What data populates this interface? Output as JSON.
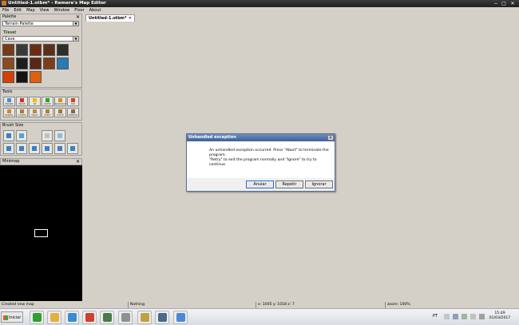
{
  "window": {
    "title": "Untitled-1.otbm* - Remere's Map Editor",
    "controls": {
      "minimize": "−",
      "maximize": "□",
      "close": "✕"
    }
  },
  "menubar": [
    "File",
    "Edit",
    "Map",
    "View",
    "Window",
    "Floor",
    "About"
  ],
  "palette": {
    "header": "Palette",
    "close": "✕",
    "selected": "Terrain Palette",
    "tileset_label": "Tileset",
    "tileset_selected": "Cave",
    "tiles": [
      {
        "name": "tile-dirt",
        "color": "#7a3a18"
      },
      {
        "name": "tile-cave-ore",
        "color": "#3a3a3a"
      },
      {
        "name": "tile-mud",
        "color": "#6b2d12"
      },
      {
        "name": "tile-mud-2",
        "color": "#5a3018"
      },
      {
        "name": "tile-stone",
        "color": "#2d2d2d"
      },
      {
        "name": "tile-rock",
        "color": "#8b4b22"
      },
      {
        "name": "tile-dark-rock",
        "color": "#1e1e1e"
      },
      {
        "name": "tile-lava-rock",
        "color": "#5b2616"
      },
      {
        "name": "tile-brown",
        "color": "#7b3e1d"
      },
      {
        "name": "tile-water",
        "color": "#2a7ab4"
      },
      {
        "name": "tile-lava",
        "color": "#d4400a"
      },
      {
        "name": "tile-black",
        "color": "#141414"
      },
      {
        "name": "tile-fire",
        "color": "#e06010"
      }
    ]
  },
  "tools": {
    "header": "Tools",
    "buttons": [
      {
        "label": "ERASER",
        "icon": "eraser-icon",
        "color": "#4a8fd8"
      },
      {
        "label": "ERASE",
        "icon": "erase-icon",
        "color": "#d23030"
      },
      {
        "label": "PZ",
        "icon": "pz-icon",
        "color": "#e8c020"
      },
      {
        "label": "NOPVP",
        "icon": "nopvp-icon",
        "color": "#30a030"
      },
      {
        "label": "NOLOGOUT",
        "icon": "nologout-icon",
        "color": "#d09020"
      },
      {
        "label": "PVP",
        "icon": "pvp-icon",
        "color": "#e04020"
      },
      {
        "label": "NORMAL",
        "icon": "normal-door-icon",
        "color": "#c88a30"
      },
      {
        "label": "LOCKED",
        "icon": "locked-door-icon",
        "color": "#b87830"
      },
      {
        "label": "MAGIC",
        "icon": "magic-door-icon",
        "color": "#c08a40"
      },
      {
        "label": "QUEST",
        "icon": "quest-door-icon",
        "color": "#b08040"
      },
      {
        "label": "HATCH",
        "icon": "hatch-door-icon",
        "color": "#a07838"
      },
      {
        "label": "WINDOW",
        "icon": "window-door-icon",
        "color": "#8a6a40"
      }
    ]
  },
  "brush": {
    "header": "Brush Size",
    "buttons": [
      {
        "name": "brush-square-small-icon",
        "color": "#3d7fc8"
      },
      {
        "name": "brush-circle-small-icon",
        "color": "#58a0d8"
      },
      {
        "name": "brush-size-1-icon",
        "color": "#c0c0c0"
      },
      {
        "name": "brush-size-2-icon",
        "color": "#90b8e0"
      },
      {
        "name": "brush-square-1-icon",
        "color": "#3d7fc8"
      },
      {
        "name": "brush-square-2-icon",
        "color": "#3d7fc8"
      },
      {
        "name": "brush-square-3-icon",
        "color": "#3d7fc8"
      },
      {
        "name": "brush-square-4-icon",
        "color": "#3d7fc8"
      },
      {
        "name": "brush-square-5-icon",
        "color": "#3d7fc8"
      },
      {
        "name": "brush-square-6-icon",
        "color": "#3d7fc8"
      }
    ]
  },
  "minimap": {
    "header": "Minimap",
    "close": "✕"
  },
  "tab": {
    "label": "Untitled-1.otbm*",
    "close": "✕"
  },
  "dialog": {
    "title": "Unhandled exception",
    "close": "✕",
    "lines": [
      "An unhandled exception occurred. Press \"Abort\" to terminate the",
      "program.",
      "\"Retry\" to exit the program normally and \"Ignore\" to try to",
      "continue."
    ],
    "buttons": {
      "abort": "Anular",
      "retry": "Repetir",
      "ignore": "Ignorar"
    }
  },
  "status": {
    "message": "Created new map",
    "item": "Nothing",
    "coords": "x: 1005 y: 1018 z: 7",
    "zoom": "zoom: 100%"
  },
  "taskbar": {
    "start": "Iniciar",
    "apps": [
      {
        "name": "green-app-icon",
        "color": "#2fa02f"
      },
      {
        "name": "folder-icon",
        "color": "#e0b040"
      },
      {
        "name": "internet-explorer-icon",
        "color": "#3a8ad8"
      },
      {
        "name": "chrome-icon",
        "color": "#d04030"
      },
      {
        "name": "vm-icon",
        "color": "#4a7a4a"
      },
      {
        "name": "app-gray-icon",
        "color": "#909090"
      },
      {
        "name": "league-icon",
        "color": "#c0a040"
      },
      {
        "name": "steam-icon",
        "color": "#4a6a8a"
      },
      {
        "name": "map-editor-icon",
        "color": "#4a8ad8"
      }
    ],
    "language": "PT",
    "time": "15:49",
    "date": "01/03/2017"
  }
}
